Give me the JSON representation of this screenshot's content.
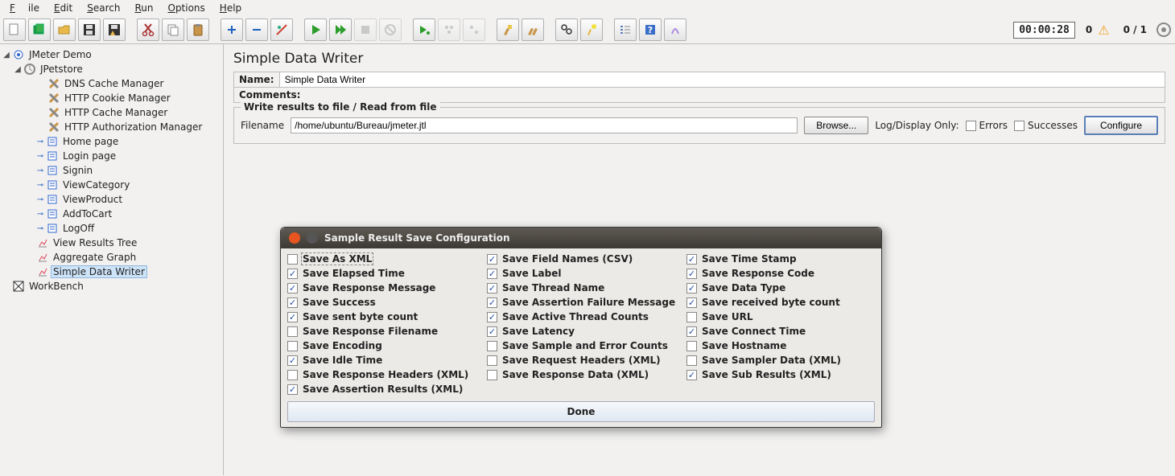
{
  "menu": {
    "file": "File",
    "edit": "Edit",
    "search": "Search",
    "run": "Run",
    "options": "Options",
    "help": "Help"
  },
  "status": {
    "timer": "00:00:28",
    "warnCount": "0",
    "threads": "0 / 1"
  },
  "tree": {
    "root": "JMeter Demo",
    "plan": "JPetstore",
    "nodes": [
      "DNS Cache Manager",
      "HTTP Cookie Manager",
      "HTTP Cache Manager",
      "HTTP Authorization Manager",
      "Home page",
      "Login page",
      "Signin",
      "ViewCategory",
      "ViewProduct",
      "AddToCart",
      "LogOff",
      "View Results Tree",
      "Aggregate Graph",
      "Simple Data Writer"
    ],
    "workbench": "WorkBench"
  },
  "panel": {
    "title": "Simple Data Writer",
    "nameLabel": "Name:",
    "nameValue": "Simple Data Writer",
    "commentsLabel": "Comments:",
    "fsLegend": "Write results to file / Read from file",
    "filenameLabel": "Filename",
    "filenameValue": "/home/ubuntu/Bureau/jmeter.jtl",
    "browse": "Browse...",
    "logonly": "Log/Display Only:",
    "errors": "Errors",
    "successes": "Successes",
    "configure": "Configure"
  },
  "dialog": {
    "title": "Sample Result Save Configuration",
    "done": "Done",
    "opts": [
      {
        "l": "Save As XML",
        "c": false
      },
      {
        "l": "Save Field Names (CSV)",
        "c": true
      },
      {
        "l": "Save Time Stamp",
        "c": true
      },
      {
        "l": "Save Elapsed Time",
        "c": true
      },
      {
        "l": "Save Label",
        "c": true
      },
      {
        "l": "Save Response Code",
        "c": true
      },
      {
        "l": "Save Response Message",
        "c": true
      },
      {
        "l": "Save Thread Name",
        "c": true
      },
      {
        "l": "Save Data Type",
        "c": true
      },
      {
        "l": "Save Success",
        "c": true
      },
      {
        "l": "Save Assertion Failure Message",
        "c": true
      },
      {
        "l": "Save received byte count",
        "c": true
      },
      {
        "l": "Save sent byte count",
        "c": true
      },
      {
        "l": "Save Active Thread Counts",
        "c": true
      },
      {
        "l": "Save URL",
        "c": false
      },
      {
        "l": "Save Response Filename",
        "c": false
      },
      {
        "l": "Save Latency",
        "c": true
      },
      {
        "l": "Save Connect Time",
        "c": true
      },
      {
        "l": "Save Encoding",
        "c": false
      },
      {
        "l": "Save Sample and Error Counts",
        "c": false
      },
      {
        "l": "Save Hostname",
        "c": false
      },
      {
        "l": "Save Idle Time",
        "c": true
      },
      {
        "l": "Save Request Headers (XML)",
        "c": false
      },
      {
        "l": "Save Sampler Data (XML)",
        "c": false
      },
      {
        "l": "Save Response Headers (XML)",
        "c": false
      },
      {
        "l": "Save Response Data (XML)",
        "c": false
      },
      {
        "l": "Save Sub Results (XML)",
        "c": true
      },
      {
        "l": "Save Assertion Results (XML)",
        "c": true
      }
    ]
  }
}
